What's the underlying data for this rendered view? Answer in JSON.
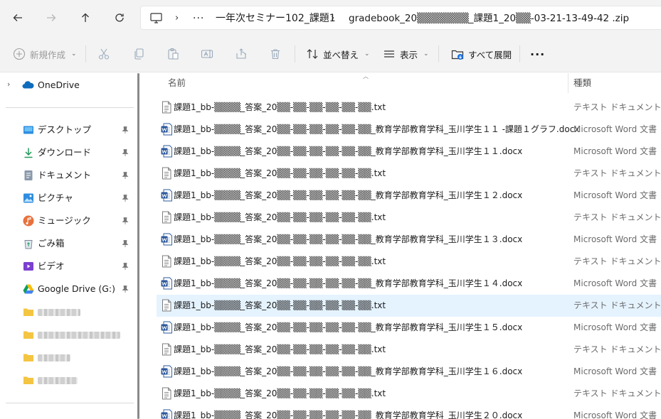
{
  "address": {
    "crumbs": [
      "一年次セミナー102_課題1",
      "gradebook_20▒▒▒▒▒▒▒_課題1_20▒▒-03-21-13-49-42 .zip"
    ],
    "overflow": "···"
  },
  "toolbar": {
    "new_label": "新規作成",
    "sort_label": "並べ替え",
    "view_label": "表示",
    "extract_all_label": "すべて展開",
    "more_label": "···"
  },
  "nav": {
    "onedrive": "OneDrive",
    "quick_access": [
      {
        "label": "デスクトップ",
        "icon": "desktop-icon"
      },
      {
        "label": "ダウンロード",
        "icon": "download-icon"
      },
      {
        "label": "ドキュメント",
        "icon": "documents-icon"
      },
      {
        "label": "ピクチャ",
        "icon": "pictures-icon"
      },
      {
        "label": "ミュージック",
        "icon": "music-icon"
      },
      {
        "label": "ごみ箱",
        "icon": "recycle-bin-icon"
      },
      {
        "label": "ビデオ",
        "icon": "videos-icon"
      },
      {
        "label": "Google Drive (G:)",
        "icon": "google-drive-icon"
      }
    ]
  },
  "columns": {
    "name": "名前",
    "type": "種類"
  },
  "files": [
    {
      "name": "課題1_bb-▒▒▒▒_答案_20▒▒-▒▒-▒▒-▒▒-▒▒-▒▒.txt",
      "type": "テキスト ドキュメント",
      "kind": "txt"
    },
    {
      "name": "課題1_bb-▒▒▒▒_答案_20▒▒-▒▒-▒▒-▒▒-▒▒-▒▒_教育学部教育学科_玉川学生１１ -課題１グラフ.docx",
      "type": "Microsoft Word 文書",
      "kind": "docx"
    },
    {
      "name": "課題1_bb-▒▒▒▒_答案_20▒▒-▒▒-▒▒-▒▒-▒▒-▒▒_教育学部教育学科_玉川学生１１.docx",
      "type": "Microsoft Word 文書",
      "kind": "docx"
    },
    {
      "name": "課題1_bb-▒▒▒▒_答案_20▒▒-▒▒-▒▒-▒▒-▒▒-▒▒.txt",
      "type": "テキスト ドキュメント",
      "kind": "txt"
    },
    {
      "name": "課題1_bb-▒▒▒▒_答案_20▒▒-▒▒-▒▒-▒▒-▒▒-▒▒_教育学部教育学科_玉川学生１２.docx",
      "type": "Microsoft Word 文書",
      "kind": "docx"
    },
    {
      "name": "課題1_bb-▒▒▒▒_答案_20▒▒-▒▒-▒▒-▒▒-▒▒-▒▒.txt",
      "type": "テキスト ドキュメント",
      "kind": "txt"
    },
    {
      "name": "課題1_bb-▒▒▒▒_答案_20▒▒-▒▒-▒▒-▒▒-▒▒-▒▒_教育学部教育学科_玉川学生１３.docx",
      "type": "Microsoft Word 文書",
      "kind": "docx"
    },
    {
      "name": "課題1_bb-▒▒▒▒_答案_20▒▒-▒▒-▒▒-▒▒-▒▒-▒▒.txt",
      "type": "テキスト ドキュメント",
      "kind": "txt"
    },
    {
      "name": "課題1_bb-▒▒▒▒_答案_20▒▒-▒▒-▒▒-▒▒-▒▒-▒▒_教育学部教育学科_玉川学生１４.docx",
      "type": "Microsoft Word 文書",
      "kind": "docx"
    },
    {
      "name": "課題1_bb-▒▒▒▒_答案_20▒▒-▒▒-▒▒-▒▒-▒▒-▒▒.txt",
      "type": "テキスト ドキュメント",
      "kind": "txt",
      "selected": true
    },
    {
      "name": "課題1_bb-▒▒▒▒_答案_20▒▒-▒▒-▒▒-▒▒-▒▒-▒▒_教育学部教育学科_玉川学生１５.docx",
      "type": "Microsoft Word 文書",
      "kind": "docx"
    },
    {
      "name": "課題1_bb-▒▒▒▒_答案_20▒▒-▒▒-▒▒-▒▒-▒▒-▒▒.txt",
      "type": "テキスト ドキュメント",
      "kind": "txt"
    },
    {
      "name": "課題1_bb-▒▒▒▒_答案_20▒▒-▒▒-▒▒-▒▒-▒▒-▒▒_教育学部教育学科_玉川学生１６.docx",
      "type": "Microsoft Word 文書",
      "kind": "docx"
    },
    {
      "name": "課題1_bb-▒▒▒▒_答案_20▒▒-▒▒-▒▒-▒▒-▒▒-▒▒.txt",
      "type": "テキスト ドキュメント",
      "kind": "txt"
    },
    {
      "name": "課題1_bb-▒▒▒▒_答案_20▒▒-▒▒-▒▒-▒▒-▒▒-▒▒_教育学部教育学科_玉川学生２０.docx",
      "type": "Microsoft Word 文書",
      "kind": "docx"
    }
  ],
  "colors": {
    "selected_row": "#e5f3ff",
    "word_blue": "#2b579a",
    "folder_yellow": "#f4c542"
  }
}
